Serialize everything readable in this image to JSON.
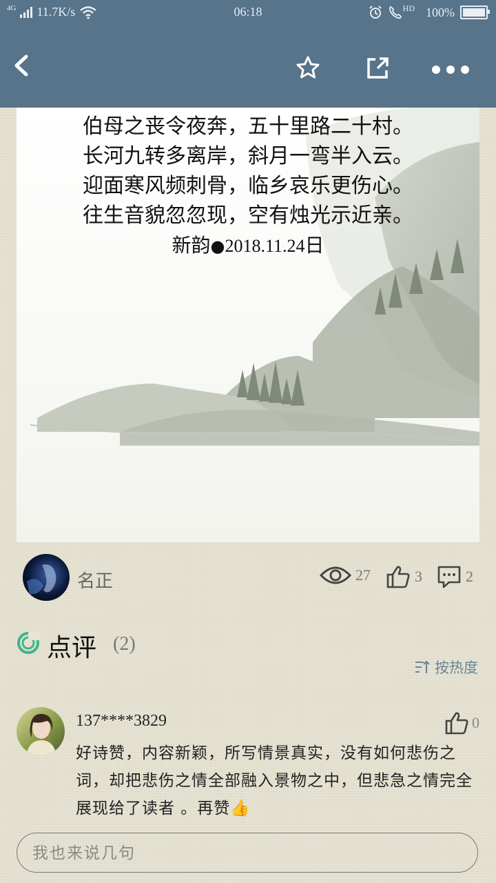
{
  "status_bar": {
    "network": "4G",
    "speed": "11.7K/s",
    "time": "06:18",
    "hd": "HD",
    "battery": "100%"
  },
  "navbar": {
    "back_icon": "back-arrow-icon",
    "favorite_icon": "star-outline-icon",
    "share_icon": "share-external-icon",
    "more_icon": "more-dots-icon"
  },
  "poem": {
    "lines": [
      "伯母之丧令夜奔，五十里路二十村。",
      "长河九转多离岸，斜月一弯半入云。",
      "迎面寒风频刺骨，临乡哀乐更伤心。",
      "往生音貌忽忽现，空有烛光示近亲。"
    ],
    "signature_name": "新韵",
    "signature_dot": "●",
    "signature_date": "2018.11.24",
    "signature_suffix": "日"
  },
  "author": {
    "name": "名正",
    "views": "27",
    "likes": "3",
    "comments": "2"
  },
  "reviews": {
    "title": "点评",
    "count": "(2)",
    "sort_label": "按热度"
  },
  "comment": {
    "user": "137****3829",
    "likes": "0",
    "text": "好诗赞，内容新颖，所写情景真实，没有如何悲伤之词，却把悲伤之情全部融入景物之中，但悲急之情完全展现给了读者 。再赞👍"
  },
  "input": {
    "placeholder": "我也来说几句"
  },
  "colors": {
    "header": "#57748b",
    "background": "#e7e4d3",
    "accent": "#6a8597"
  }
}
